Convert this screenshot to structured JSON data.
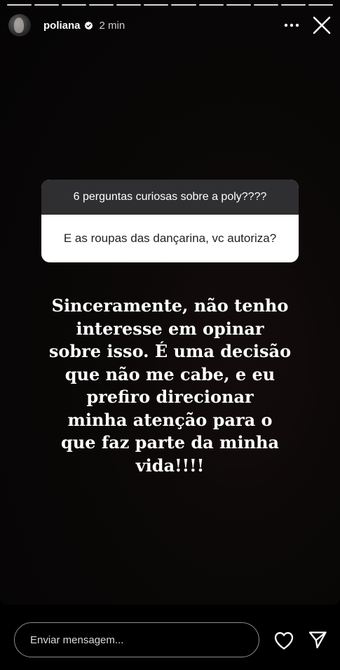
{
  "header": {
    "username": "poliana",
    "time": "2 min",
    "verified": true
  },
  "progress": {
    "segment_count": 12,
    "current_segment": 12
  },
  "question_sticker": {
    "title": "6 perguntas curiosas sobre a poly????",
    "question": "E as roupas das dançarina, vc autoriza?"
  },
  "answer": {
    "lines": [
      "Sinceramente, não tenho",
      "interesse em opinar",
      "sobre isso. É uma decisão",
      "que não me cabe, e eu",
      "prefiro direcionar",
      "minha atenção para o",
      "que faz parte da minha",
      "vida!!!!"
    ]
  },
  "footer": {
    "message_placeholder": "Enviar mensagem..."
  },
  "icons": {
    "more": "more-horizontal-icon",
    "close": "close-icon",
    "like": "heart-icon",
    "send": "send-icon",
    "verified": "verified-badge-icon"
  },
  "colors": {
    "background": "#000000",
    "sticker_header": "#2f2f31",
    "sticker_body": "#ffffff"
  }
}
